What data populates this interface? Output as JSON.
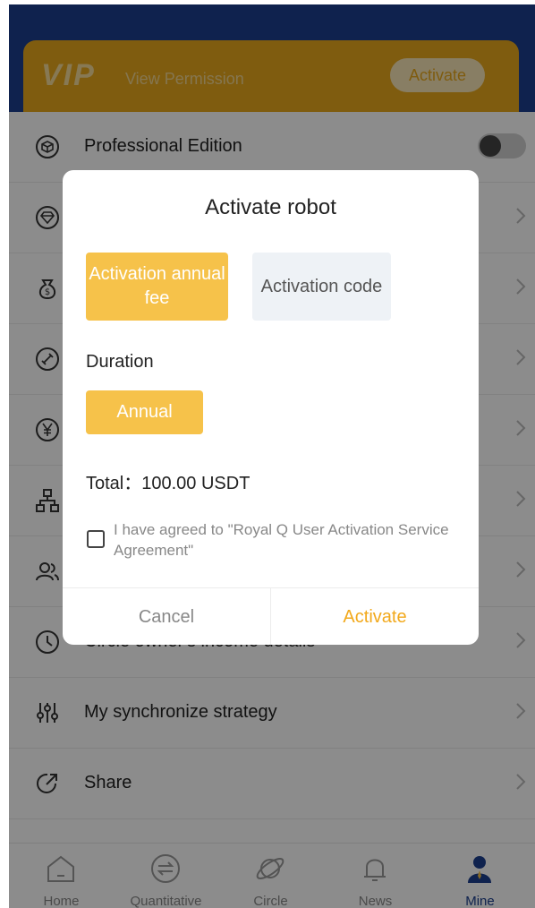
{
  "header": {
    "vip_logo": "VIP",
    "view_permission": "View Permission",
    "activate_button": "Activate"
  },
  "menu": [
    {
      "label": "Professional Edition",
      "icon": "cube-icon",
      "control": "toggle",
      "toggle_on": false
    },
    {
      "label": "",
      "icon": "diamond-icon",
      "control": "chevron"
    },
    {
      "label": "",
      "icon": "money-bag-icon",
      "control": "chevron"
    },
    {
      "label": "",
      "icon": "link-icon",
      "control": "chevron"
    },
    {
      "label": "",
      "icon": "yen-icon",
      "control": "chevron"
    },
    {
      "label": "",
      "icon": "org-chart-icon",
      "control": "chevron"
    },
    {
      "label": "",
      "icon": "users-icon",
      "control": "chevron"
    },
    {
      "label": "Circle owner's income details",
      "icon": "clock-icon",
      "control": "chevron"
    },
    {
      "label": "My synchronize strategy",
      "icon": "sliders-icon",
      "control": "chevron"
    },
    {
      "label": "Share",
      "icon": "share-icon",
      "control": "chevron"
    },
    {
      "label": "",
      "icon": "feedback-icon",
      "control": "chevron"
    }
  ],
  "tabbar": {
    "tabs": [
      {
        "label": "Home",
        "icon": "home-icon",
        "active": false
      },
      {
        "label": "Quantitative",
        "icon": "swap-icon",
        "active": false
      },
      {
        "label": "Circle",
        "icon": "planet-icon",
        "active": false
      },
      {
        "label": "News",
        "icon": "bell-icon",
        "active": false
      },
      {
        "label": "Mine",
        "icon": "user-icon",
        "active": true
      }
    ]
  },
  "dialog": {
    "title": "Activate robot",
    "option_fee": "Activation annual fee",
    "option_code": "Activation code",
    "duration_label": "Duration",
    "duration_value": "Annual",
    "total": "Total：100.00 USDT",
    "agreement_checked": false,
    "agreement_text": "I have agreed to \"Royal Q User Activation Service Agreement\"",
    "cancel_button": "Cancel",
    "activate_button": "Activate"
  },
  "colors": {
    "header_blue": "#1c3f8e",
    "vip_gold": "#e7a81d",
    "accent_yellow": "#f6c24a",
    "activate_text": "#f2a91c"
  }
}
